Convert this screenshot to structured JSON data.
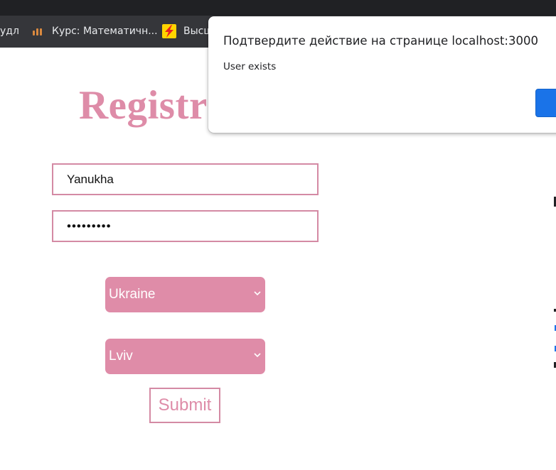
{
  "browser": {
    "bookmarks": [
      {
        "label": "удл"
      },
      {
        "label": "Курс: Математичн...",
        "icon": "moodle-icon"
      },
      {
        "label": "Высш",
        "icon": "lightning-icon"
      }
    ]
  },
  "page": {
    "title": "Registra",
    "username_value": "Yanukha",
    "password_mask": "•••••••••",
    "country_selected": "Ukraine",
    "city_selected": "Lviv",
    "submit_label": "Submit",
    "accent_color": "#de8ca8"
  },
  "dialog": {
    "title": "Подтвердите действие на странице localhost:3000",
    "message": "User exists",
    "ok_color": "#1a73e8"
  }
}
